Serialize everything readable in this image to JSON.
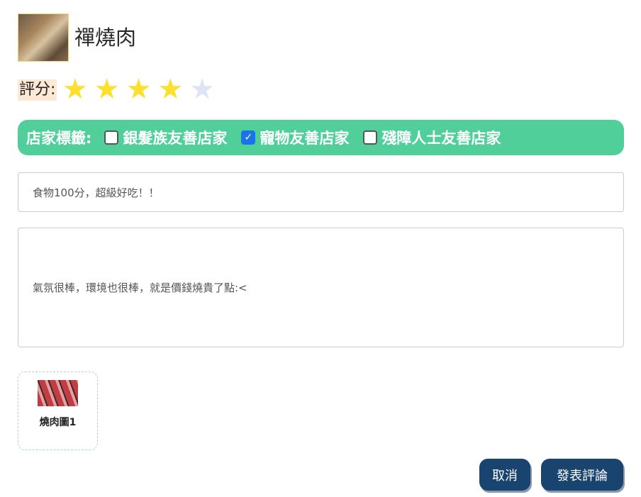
{
  "restaurant": {
    "name": "禪燒肉"
  },
  "rating": {
    "label": "評分:",
    "value": 4,
    "max": 5,
    "filled_color": "#fde02b",
    "empty_color": "#dfe4f5"
  },
  "tags": {
    "label": "店家標籤:",
    "items": [
      {
        "label": "銀髮族友善店家",
        "checked": false
      },
      {
        "label": "寵物友善店家",
        "checked": true
      },
      {
        "label": "殘障人士友善店家",
        "checked": false
      }
    ]
  },
  "review": {
    "title": "食物100分，超級好吃！！",
    "content": "氣氛很棒，環境也很棒，就是價錢燒貴了點:<"
  },
  "photos": [
    {
      "label": "燒肉圖1"
    }
  ],
  "buttons": {
    "cancel": "取消",
    "submit": "發表評論"
  },
  "colors": {
    "tag_bar": "#50cf9b",
    "button": "#1a4470"
  }
}
